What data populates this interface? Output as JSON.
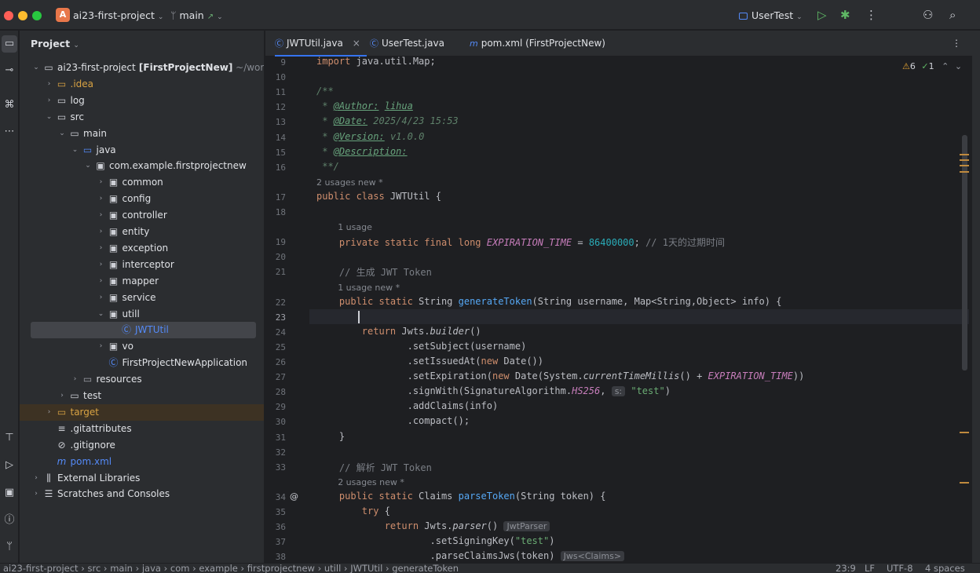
{
  "titlebar": {
    "project_badge": "A",
    "project_name": "ai23-first-project",
    "branch": "main",
    "run_config": "UserTest",
    "colors": {
      "close": "#ff5f57",
      "minimize": "#febc2e",
      "maximize": "#28c840",
      "badge": "#e8774a"
    }
  },
  "project_panel": {
    "title": "Project",
    "tree": [
      {
        "name": "ai23-first-project",
        "suffix": "[FirstProjectNew]",
        "path": "~/workspace",
        "depth": 0,
        "expanded": true,
        "icon": "module-folder-icon"
      },
      {
        "name": ".idea",
        "depth": 1,
        "expanded": false,
        "icon": "folder-icon",
        "color": "#d9a343"
      },
      {
        "name": "log",
        "depth": 1,
        "expanded": false,
        "icon": "folder-icon"
      },
      {
        "name": "src",
        "depth": 1,
        "expanded": true,
        "icon": "folder-icon"
      },
      {
        "name": "main",
        "depth": 2,
        "expanded": true,
        "icon": "folder-icon"
      },
      {
        "name": "java",
        "depth": 3,
        "expanded": true,
        "icon": "source-folder-icon"
      },
      {
        "name": "com.example.firstprojectnew",
        "depth": 4,
        "expanded": true,
        "icon": "package-icon"
      },
      {
        "name": "common",
        "depth": 5,
        "expanded": false,
        "icon": "package-icon"
      },
      {
        "name": "config",
        "depth": 5,
        "expanded": false,
        "icon": "package-icon"
      },
      {
        "name": "controller",
        "depth": 5,
        "expanded": false,
        "icon": "package-icon"
      },
      {
        "name": "entity",
        "depth": 5,
        "expanded": false,
        "icon": "package-icon"
      },
      {
        "name": "exception",
        "depth": 5,
        "expanded": false,
        "icon": "package-icon"
      },
      {
        "name": "interceptor",
        "depth": 5,
        "expanded": false,
        "icon": "package-icon"
      },
      {
        "name": "mapper",
        "depth": 5,
        "expanded": false,
        "icon": "package-icon"
      },
      {
        "name": "service",
        "depth": 5,
        "expanded": false,
        "icon": "package-icon"
      },
      {
        "name": "utill",
        "depth": 5,
        "expanded": true,
        "icon": "package-icon"
      },
      {
        "name": "JWTUtil",
        "depth": 6,
        "icon": "class-icon",
        "selected": true,
        "color": "#548af7"
      },
      {
        "name": "vo",
        "depth": 5,
        "expanded": false,
        "icon": "package-icon"
      },
      {
        "name": "FirstProjectNewApplication",
        "depth": 5,
        "icon": "spring-class-icon"
      },
      {
        "name": "resources",
        "depth": 3,
        "expanded": false,
        "icon": "resources-folder-icon"
      },
      {
        "name": "test",
        "depth": 2,
        "expanded": false,
        "icon": "folder-icon"
      },
      {
        "name": "target",
        "depth": 1,
        "expanded": false,
        "icon": "folder-icon",
        "color": "#d9a343",
        "excluded": true
      },
      {
        "name": ".gitattributes",
        "depth": 1,
        "icon": "file-icon"
      },
      {
        "name": ".gitignore",
        "depth": 1,
        "icon": "ignore-file-icon"
      },
      {
        "name": "pom.xml",
        "depth": 1,
        "icon": "maven-icon",
        "color": "#548af7"
      },
      {
        "name": "External Libraries",
        "depth": 0,
        "expanded": false,
        "icon": "library-icon"
      },
      {
        "name": "Scratches and Consoles",
        "depth": 0,
        "expanded": false,
        "icon": "scratches-icon"
      }
    ]
  },
  "tabs": [
    {
      "label": "JWTUtil.java",
      "active": true,
      "closable": true,
      "icon": "class-icon"
    },
    {
      "label": "UserTest.java",
      "active": false,
      "icon": "class-icon"
    },
    {
      "label": "pom.xml (FirstProjectNew)",
      "active": false,
      "icon": "maven-icon"
    }
  ],
  "inspections": {
    "warnings": "6",
    "ok": "1"
  },
  "editor": {
    "lines": [
      {
        "n": "9",
        "html": "<span class='kw'>import</span> java.util.Map;"
      },
      {
        "n": "10",
        "html": ""
      },
      {
        "n": "11",
        "html": "<span class='doc'>/**</span>"
      },
      {
        "n": "12",
        "html": "<span class='doc'> * </span><span class='doctag'>@Author:</span><span class='doc'> </span><span class='doctag'>lihua</span>"
      },
      {
        "n": "13",
        "html": "<span class='doc'> * </span><span class='doctag'>@Date:</span><span class='doc'> 2025/4/23 15:53</span>"
      },
      {
        "n": "14",
        "html": "<span class='doc'> * </span><span class='doctag'>@Version:</span><span class='doc'> v1.0.0</span>"
      },
      {
        "n": "15",
        "html": "<span class='doc'> * </span><span class='doctag'>@Description:</span>"
      },
      {
        "n": "16",
        "html": "<span class='doc'> **/</span>"
      },
      {
        "hint": "2 usages   new *",
        "indent": 0
      },
      {
        "n": "17",
        "html": "<span class='kw'>public class</span> JWTUtil {"
      },
      {
        "n": "18",
        "html": ""
      },
      {
        "hint": "1 usage",
        "indent": 4
      },
      {
        "n": "19",
        "html": "    <span class='kw'>private static final long</span> <span class='const'>EXPIRATION_TIME</span> = <span class='num'>86400000</span>; <span class='cmt'>// 1天的过期时间</span>"
      },
      {
        "n": "20",
        "html": ""
      },
      {
        "n": "21",
        "html": "    <span class='cmt'>// 生成 JWT Token</span>"
      },
      {
        "hint": "1 usage   new *",
        "indent": 4
      },
      {
        "n": "22",
        "html": "    <span class='kw'>public static</span> String <span class='fn'>generateToken</span>(String username, Map&lt;String,Object&gt; info) {"
      },
      {
        "n": "23",
        "html": "",
        "current": true
      },
      {
        "n": "24",
        "html": "        <span class='kw'>return</span> Jwts.<span class='it'>builder</span>()"
      },
      {
        "n": "25",
        "html": "                .setSubject(username)"
      },
      {
        "n": "26",
        "html": "                .setIssuedAt(<span class='kw'>new</span> Date())"
      },
      {
        "n": "27",
        "html": "                .setExpiration(<span class='kw'>new</span> Date(System.<span class='it'>currentTimeMillis</span>() + <span class='const'>EXPIRATION_TIME</span>))"
      },
      {
        "n": "28",
        "html": "                .signWith(SignatureAlgorithm.<span class='const'>HS256</span>, <span class='inlay'>s:</span> <span class='str'>\"test\"</span>)"
      },
      {
        "n": "29",
        "html": "                .addClaims(info)"
      },
      {
        "n": "30",
        "html": "                .compact();"
      },
      {
        "n": "31",
        "html": "    }"
      },
      {
        "n": "32",
        "html": ""
      },
      {
        "n": "33",
        "html": "    <span class='cmt'>// 解析 JWT Token</span>"
      },
      {
        "hint": "2 usages   new *",
        "indent": 4
      },
      {
        "n": "34",
        "html": "    <span class='kw'>public static</span> Claims <span class='fn'>parseToken</span>(String token) {",
        "annotation": "@"
      },
      {
        "n": "35",
        "html": "        <span class='kw'>try</span> {"
      },
      {
        "n": "36",
        "html": "            <span class='kw'>return</span> Jwts.<span class='it'>parser</span>() <span class='inlay'>JwtParser</span>"
      },
      {
        "n": "37",
        "html": "                    .setSigningKey(<span class='str'>\"test\"</span>)"
      },
      {
        "n": "38",
        "html": "                    .parseClaimsJws(token) <span class='inlay'>Jws&lt;Claims&gt;</span>"
      }
    ]
  },
  "statusbar": {
    "breadcrumbs": [
      "ai23-first-project",
      "src",
      "main",
      "java",
      "com",
      "example",
      "firstprojectnew",
      "utill",
      "JWTUtil",
      "generateToken"
    ],
    "position": "23:9",
    "line_sep": "LF",
    "encoding": "UTF-8",
    "indent": "4 spaces"
  }
}
